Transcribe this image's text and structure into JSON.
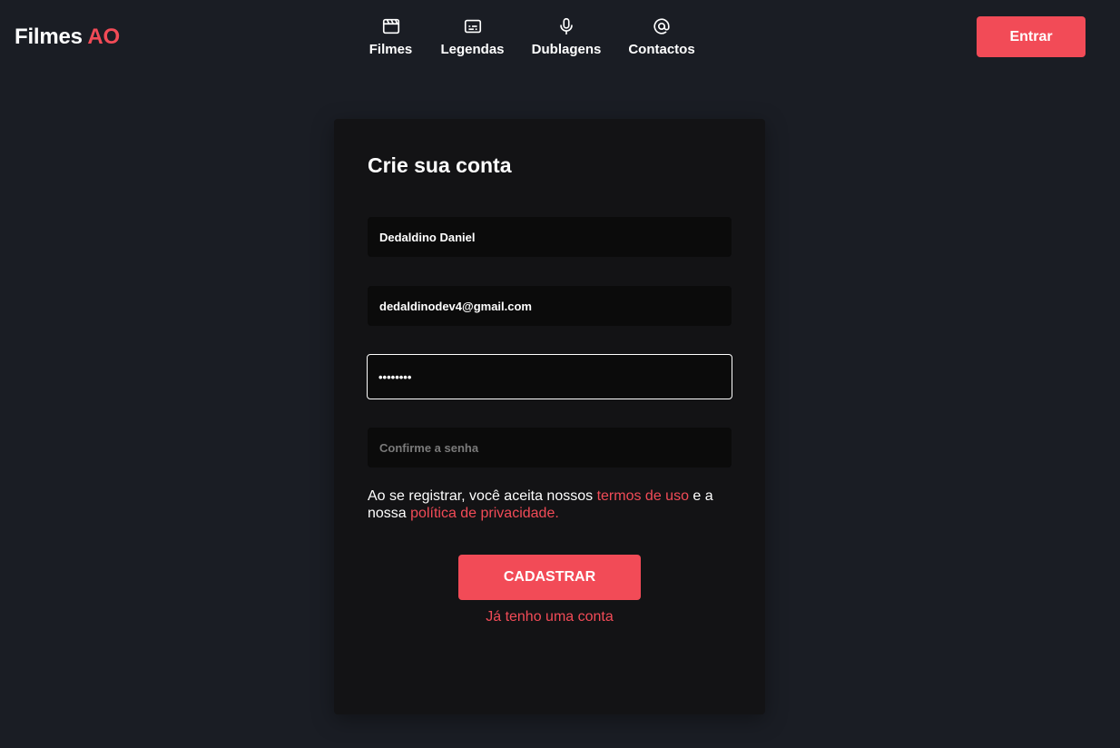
{
  "header": {
    "logo_main": "Filmes",
    "logo_accent": "AO",
    "login_label": "Entrar"
  },
  "nav": [
    {
      "label": "Filmes",
      "icon": "clapperboard-icon"
    },
    {
      "label": "Legendas",
      "icon": "subtitles-icon"
    },
    {
      "label": "Dublagens",
      "icon": "microphone-icon"
    },
    {
      "label": "Contactos",
      "icon": "at-sign-icon"
    }
  ],
  "form": {
    "title": "Crie sua conta",
    "name_value": "Dedaldino Daniel",
    "email_value": "dedaldinodev4@gmail.com",
    "password_value": "12345678",
    "confirm_placeholder": "Confirme a senha",
    "terms_prefix": "Ao se registrar, você aceita nossos ",
    "terms_link": "termos de uso",
    "terms_middle": " e a nossa ",
    "privacy_link": "política de privacidade.",
    "submit_label": "CADASTRAR",
    "have_account_label": "Já tenho uma conta"
  },
  "colors": {
    "accent": "#f24b57",
    "background": "#1a1d24",
    "card": "#131315",
    "field": "#0b0b0b"
  }
}
